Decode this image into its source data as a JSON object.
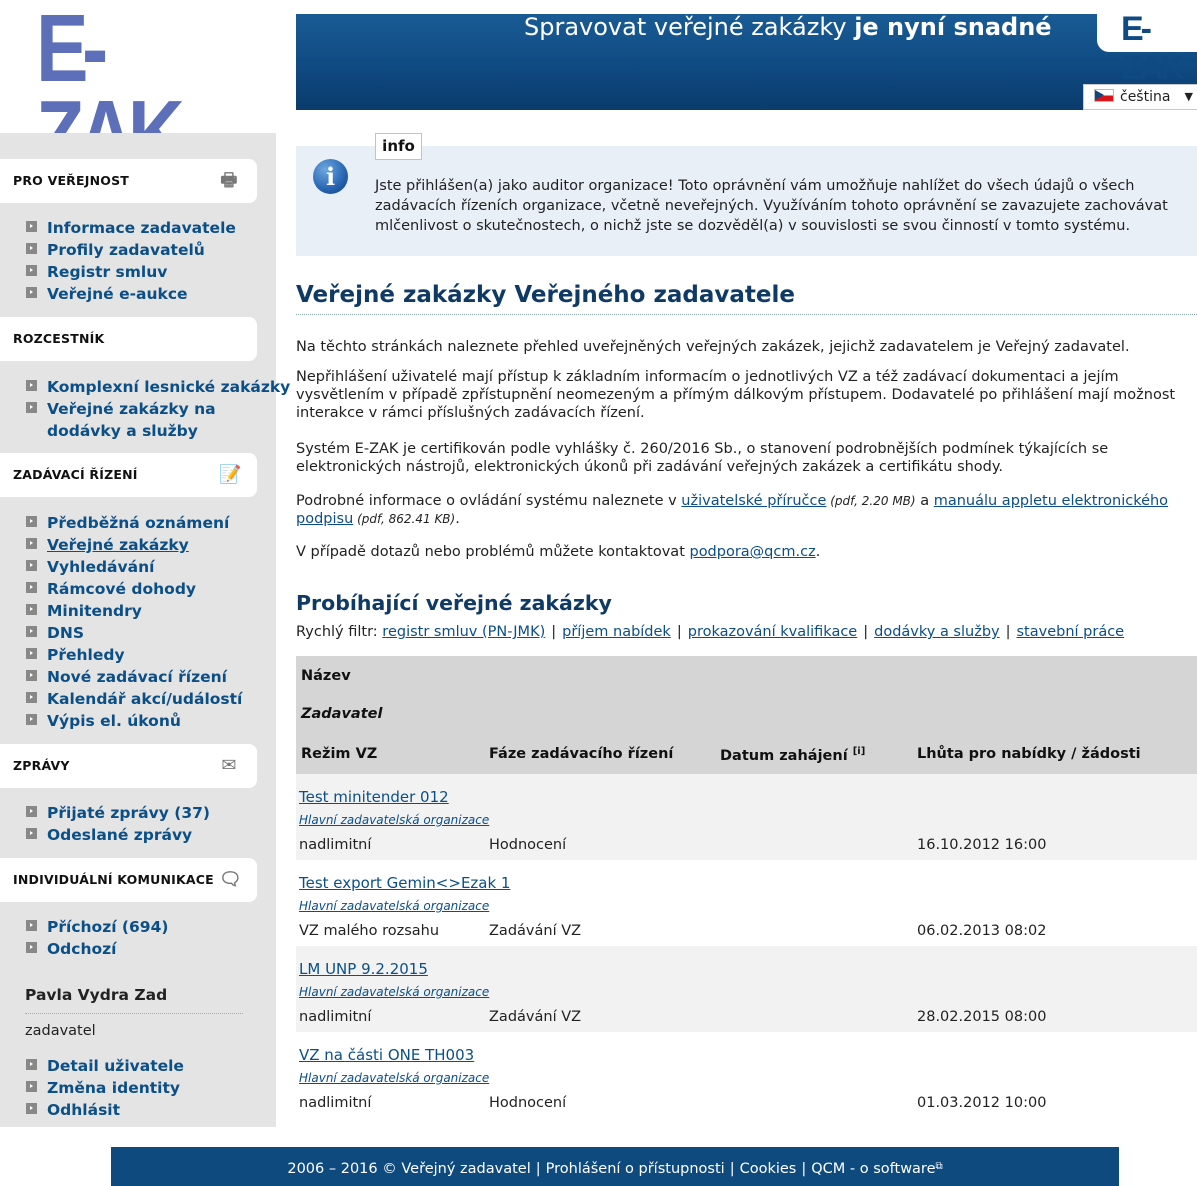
{
  "header": {
    "logo": "E-ZAK",
    "slogan_normal": "Spravovat veřejné zakázky ",
    "slogan_bold": "je nyní snadné",
    "banner_logo": "E-ZAK",
    "language": "čeština"
  },
  "sidebar": {
    "sections": [
      {
        "title": "PRO VEŘEJNOST",
        "items": [
          "Informace zadavatele",
          "Profily zadavatelů",
          "Registr smluv",
          "Veřejné e-aukce"
        ]
      },
      {
        "title": "ROZCESTNÍK",
        "items": [
          "Komplexní lesnické zakázky",
          "Veřejné zakázky na dodávky a služby"
        ]
      },
      {
        "title": "ZADÁVACÍ ŘÍZENÍ",
        "items": [
          "Předběžná oznámení",
          "Veřejné zakázky",
          "Vyhledávání",
          "Rámcové dohody",
          "Minitendry",
          "DNS",
          "Přehledy",
          "Nové zadávací řízení",
          "Kalendář akcí/událostí",
          "Výpis el. úkonů"
        ]
      },
      {
        "title": "ZPRÁVY",
        "items": [
          "Přijaté zprávy (37)",
          "Odeslané zprávy"
        ]
      },
      {
        "title": "INDIVIDUÁLNÍ KOMUNIKACE",
        "items": [
          "Příchozí (694)",
          "Odchozí"
        ]
      }
    ],
    "user": {
      "name": "Pavla Vydra Zad",
      "role": "zadavatel",
      "items": [
        "Detail uživatele",
        "Změna identity",
        "Odhlásit"
      ]
    }
  },
  "info": {
    "tab": "info",
    "text": "Jste přihlášen(a) jako auditor organizace! Toto oprávnění vám umožňuje nahlížet do všech údajů o všech zadávacích řízeních organizace, včetně neveřejných. Využíváním tohoto oprávnění se zavazujete zachovávat mlčenlivost o skutečnostech, o nichž jste se dozvěděl(a) v souvislosti se svou činností v tomto systému."
  },
  "main": {
    "title": "Veřejné zakázky Veřejného zadavatele",
    "p1": "Na těchto stránkách naleznete přehled uveřejněných veřejných zakázek, jejichž zadavatelem je Veřejný zadavatel.",
    "p2": "Nepřihlášení uživatelé mají přístup k základním informacím o jednotlivých VZ a též zadávací dokumentaci a jejím vysvětlením v případě zpřístupnění neomezeným a přímým dálkovým přístupem. Dodavatelé po přihlášení mají možnost interakce v rámci příslušných zadávacích řízení.",
    "p3": "Systém E-ZAK je certifikován podle vyhlášky č. 260/2016 Sb., o stanovení podrobnějších podmínek týkajících se elektronických nástrojů, elektronických úkonů při zadávání veřejných zakázek a certifikátu shody.",
    "p4_a": "Podrobné informace o ovládání systému naleznete v ",
    "p4_link1": "uživatelské příručce",
    "p4_b": " (pdf, 2.20 MB)",
    "p4_c": " a ",
    "p4_link2": "manuálu appletu elektronického podpisu",
    "p4_d": " (pdf, 862.41 KB)",
    "p4_e": ".",
    "p5_a": "V případě dotazů nebo problémů můžete kontaktovat ",
    "p5_link": "podpora@qcm.cz",
    "p5_b": ".",
    "running_title": "Probíhající veřejné zakázky",
    "filter_label": "Rychlý filtr: ",
    "filters": [
      "registr smluv (PN-JMK)",
      "příjem nabídek",
      "prokazování kvalifikace",
      "dodávky a služby",
      "stavební práce"
    ]
  },
  "table": {
    "headers": {
      "name": "Název",
      "contracting": "Zadavatel",
      "mode": "Režim VZ",
      "phase": "Fáze zadávacího řízení",
      "start": "Datum zahájení",
      "start_hint": "[i]",
      "deadline": "Lhůta pro nabídky / žádosti"
    },
    "rows": [
      {
        "name": "Test minitender 012",
        "org": "Hlavní zadavatelská organizace",
        "mode": "nadlimitní",
        "phase": "Hodnocení",
        "start": "",
        "deadline": "16.10.2012 16:00"
      },
      {
        "name": "Test export Gemin<>Ezak 1",
        "org": "Hlavní zadavatelská organizace",
        "mode": "VZ malého rozsahu",
        "phase": "Zadávání VZ",
        "start": "",
        "deadline": "06.02.2013 08:02"
      },
      {
        "name": "LM UNP 9.2.2015",
        "org": "Hlavní zadavatelská organizace",
        "mode": "nadlimitní",
        "phase": "Zadávání VZ",
        "start": "",
        "deadline": "28.02.2015 08:00"
      },
      {
        "name": "VZ na části ONE TH003",
        "org": "Hlavní zadavatelská organizace",
        "mode": "nadlimitní",
        "phase": "Hodnocení",
        "start": "",
        "deadline": "01.03.2012 10:00"
      }
    ]
  },
  "footer": {
    "copyright": "2006 – 2016 © Veřejný zadavatel",
    "links": [
      "Prohlášení o přístupnosti",
      "Cookies",
      "QCM - o software"
    ]
  },
  "colors": {
    "banner": "#0f4a82",
    "link": "#0b4f86",
    "heading": "#0f3a66",
    "sidebar_bg": "#e4e4e4",
    "info_bg": "#e8eff6"
  }
}
